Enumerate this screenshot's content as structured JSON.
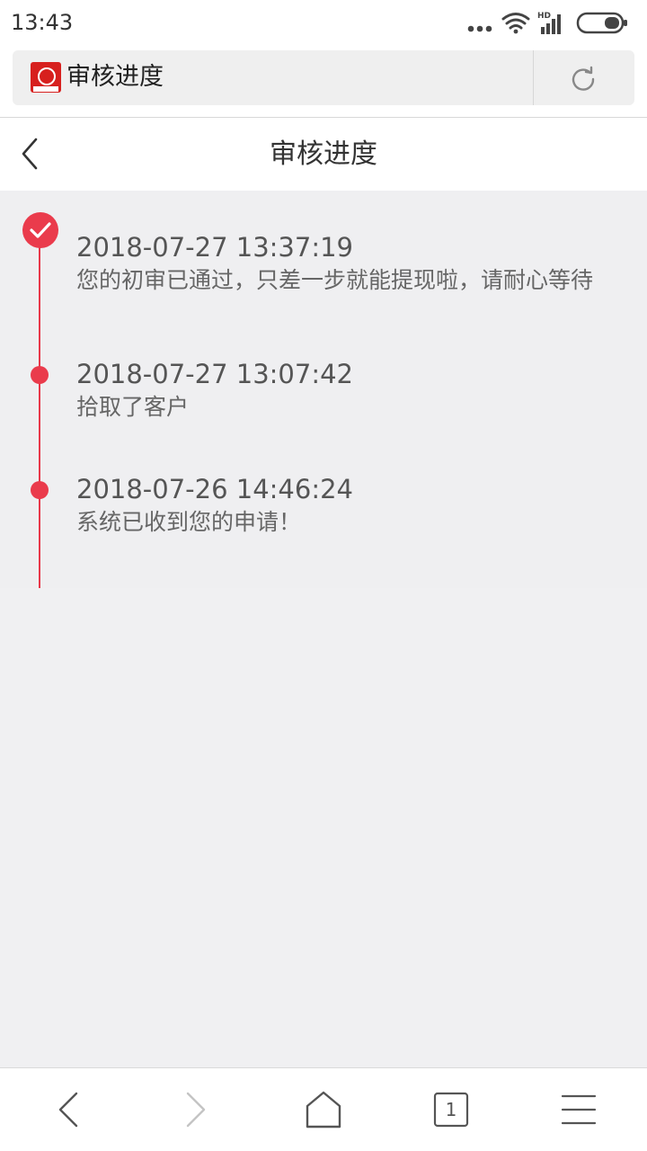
{
  "status_bar": {
    "time": "13:43",
    "network_label": "HD"
  },
  "browser": {
    "tab_title": "审核进度",
    "icons": [
      "site-logo",
      "refresh-icon"
    ]
  },
  "header": {
    "title": "审核进度",
    "back_icon": "chevron-left-icon"
  },
  "timeline": {
    "accent_color": "#ea3b4c",
    "entries": [
      {
        "time": "2018-07-27 13:37:19",
        "message": "您的初审已通过，只差一步就能提现啦，请耐心等待",
        "status": "done"
      },
      {
        "time": "2018-07-27 13:07:42",
        "message": "拾取了客户",
        "status": "step"
      },
      {
        "time": "2018-07-26 14:46:24",
        "message": "系统已收到您的申请！",
        "status": "step"
      }
    ]
  },
  "bottom_nav": {
    "items": [
      "back-icon",
      "forward-icon",
      "home-icon",
      "tabs-icon",
      "menu-icon"
    ],
    "tab_count": "1"
  }
}
